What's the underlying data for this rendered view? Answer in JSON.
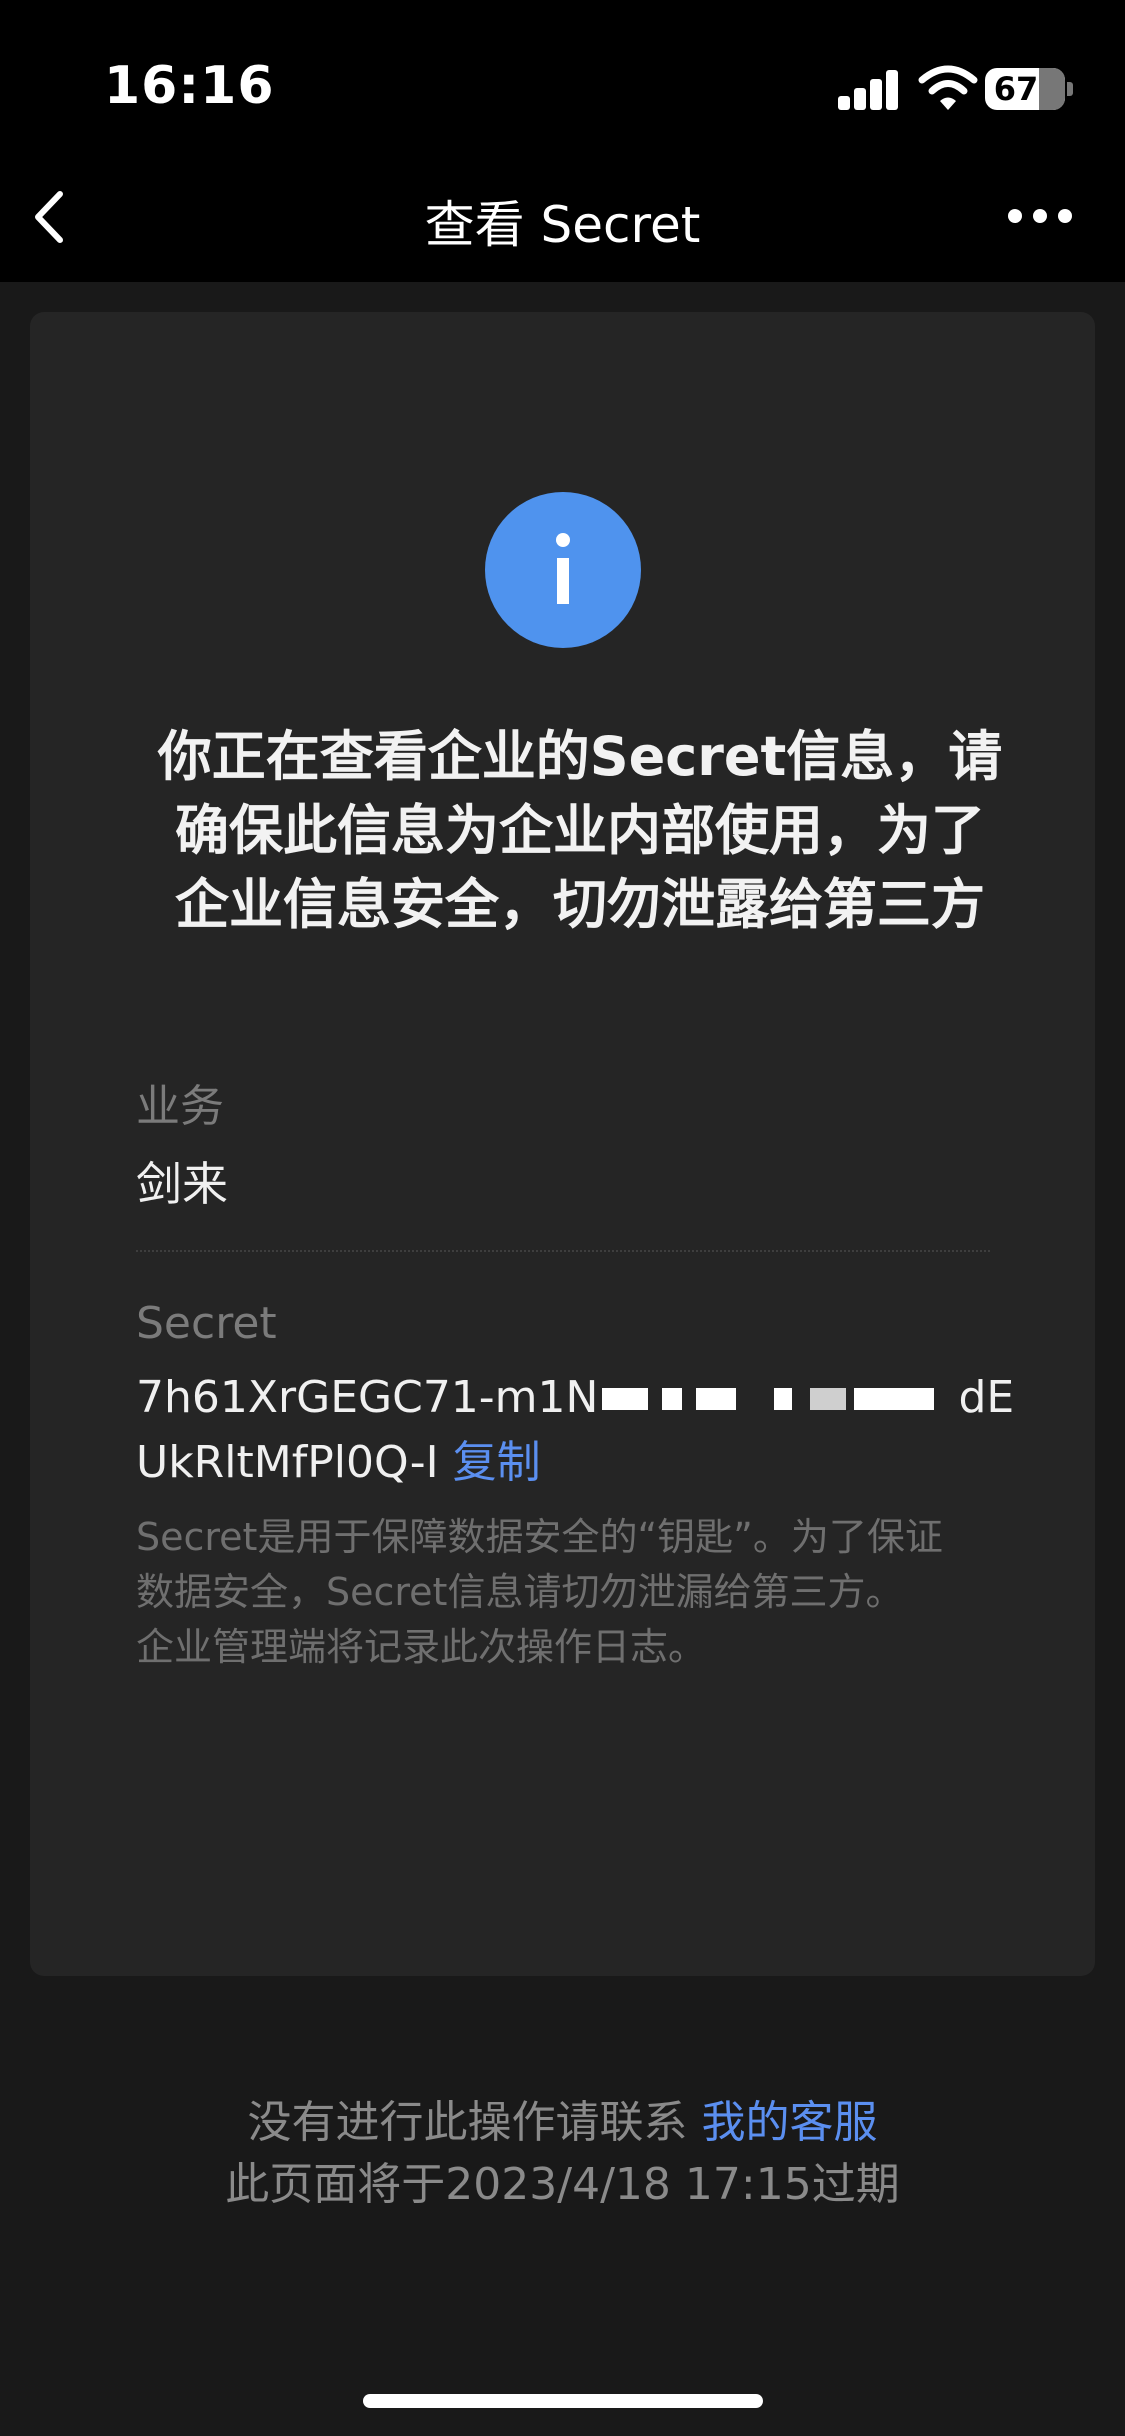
{
  "status_bar": {
    "time": "16:16",
    "battery": "67"
  },
  "nav": {
    "title": "查看 Secret"
  },
  "card": {
    "headline_lines": [
      "你正在查看企业的Secret信息，请",
      "确保此信息为企业内部使用，为了",
      "企业信息安全，切勿泄露给第三方"
    ],
    "business_label": "业务",
    "business_value": "剑来",
    "secret_label": "Secret",
    "secret_line1_prefix": "7h61XrGEGC71-m1N",
    "secret_line1_suffix": "dE",
    "secret_line2": "UkRltMfPl0Q-I",
    "copy_label": "复制",
    "note_lines": [
      "Secret是用于保障数据安全的“钥匙”。为了保证",
      "数据安全，Secret信息请切勿泄漏给第三方。",
      "企业管理端将记录此次操作日志。"
    ]
  },
  "footer": {
    "contact_text": "没有进行此操作请联系",
    "contact_link": "我的客服",
    "expiry_text": "此页面将于2023/4/18 17:15过期"
  }
}
